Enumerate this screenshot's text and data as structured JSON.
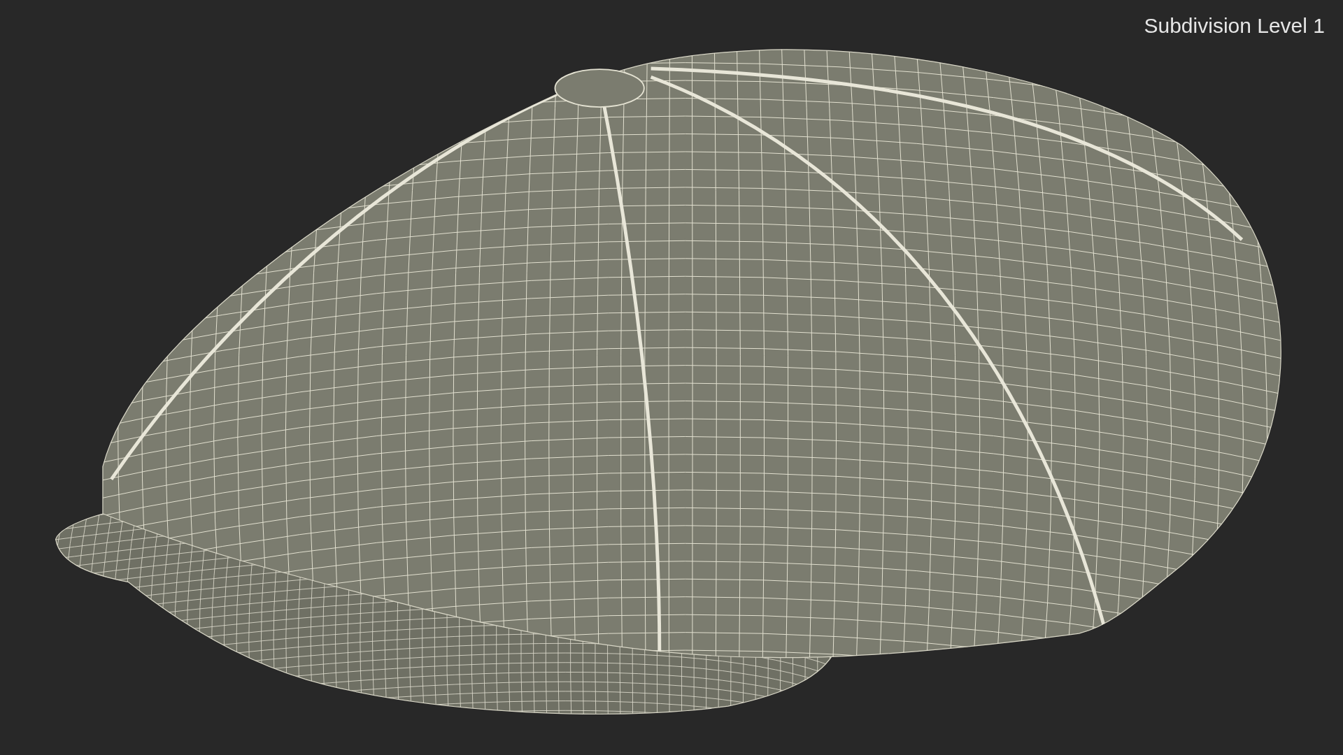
{
  "viewport": {
    "label": "Subdivision Level 1"
  }
}
